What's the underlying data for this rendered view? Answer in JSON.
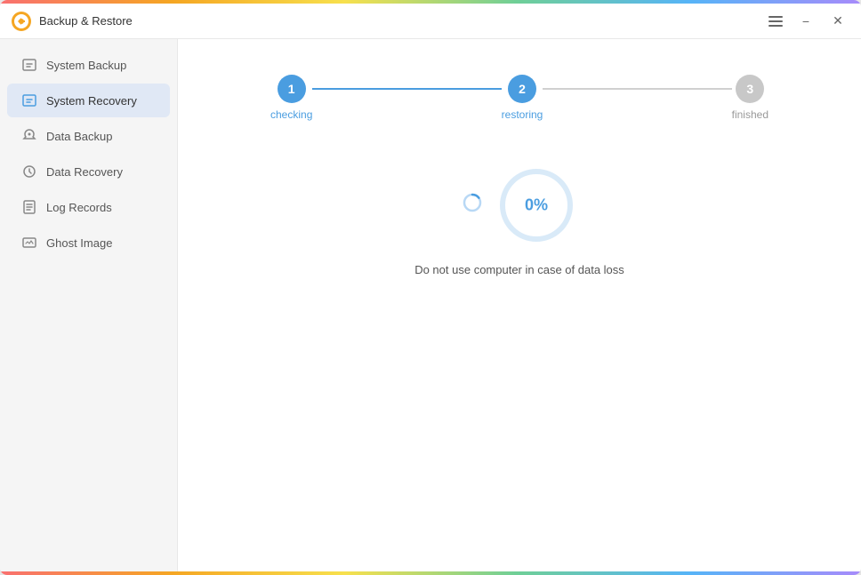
{
  "app": {
    "title": "Backup & Restore",
    "icon_label": "app-icon"
  },
  "titlebar": {
    "hamburger_title": "menu",
    "minimize_label": "minimize",
    "close_label": "close"
  },
  "sidebar": {
    "items": [
      {
        "id": "system-backup",
        "label": "System Backup",
        "icon": "backup",
        "active": false
      },
      {
        "id": "system-recovery",
        "label": "System Recovery",
        "icon": "recovery",
        "active": true
      },
      {
        "id": "data-backup",
        "label": "Data Backup",
        "icon": "data-backup",
        "active": false
      },
      {
        "id": "data-recovery",
        "label": "Data Recovery",
        "icon": "data-recovery",
        "active": false
      },
      {
        "id": "log-records",
        "label": "Log Records",
        "icon": "log",
        "active": false
      },
      {
        "id": "ghost-image",
        "label": "Ghost Image",
        "icon": "ghost",
        "active": false
      }
    ]
  },
  "steps": [
    {
      "number": "1",
      "label": "checking",
      "active": true
    },
    {
      "number": "2",
      "label": "restoring",
      "active": true
    },
    {
      "number": "3",
      "label": "finished",
      "active": false
    }
  ],
  "progress": {
    "percentage": "0%",
    "message": "Do not use computer in case of data loss"
  }
}
